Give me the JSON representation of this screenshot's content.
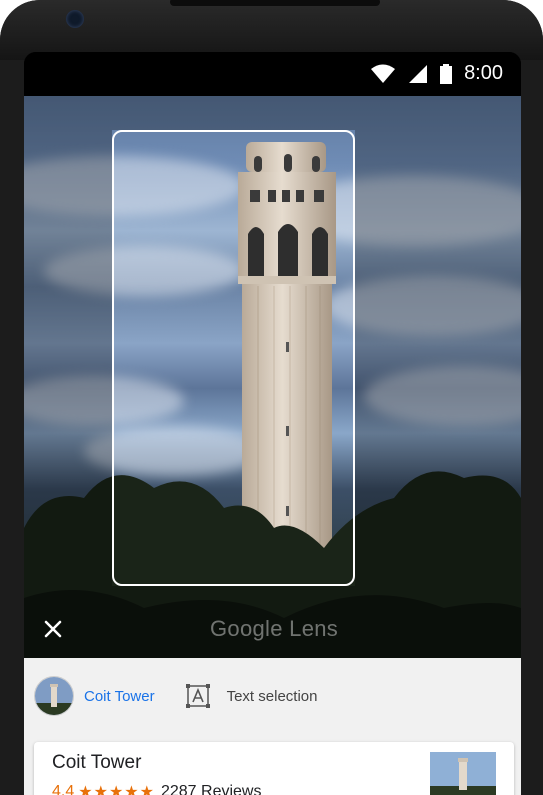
{
  "status_bar": {
    "time": "8:00",
    "icons": [
      "wifi-icon",
      "cellular-signal-icon",
      "battery-icon"
    ]
  },
  "viewfinder": {
    "watermark": "Google Lens",
    "close_icon": "close-icon"
  },
  "chips": [
    {
      "label": "Coit Tower",
      "active": true,
      "icon": "coit-tower-thumbnail"
    },
    {
      "label": "Text selection",
      "active": false,
      "icon": "text-selection-icon"
    }
  ],
  "result_card": {
    "title": "Coit Tower",
    "rating": "4.4",
    "stars": "★★★★★",
    "reviews": "2287 Reviews"
  },
  "colors": {
    "accent": "#1a73e8",
    "rating": "#e8710a",
    "sheet_bg": "#f1f1f1"
  }
}
